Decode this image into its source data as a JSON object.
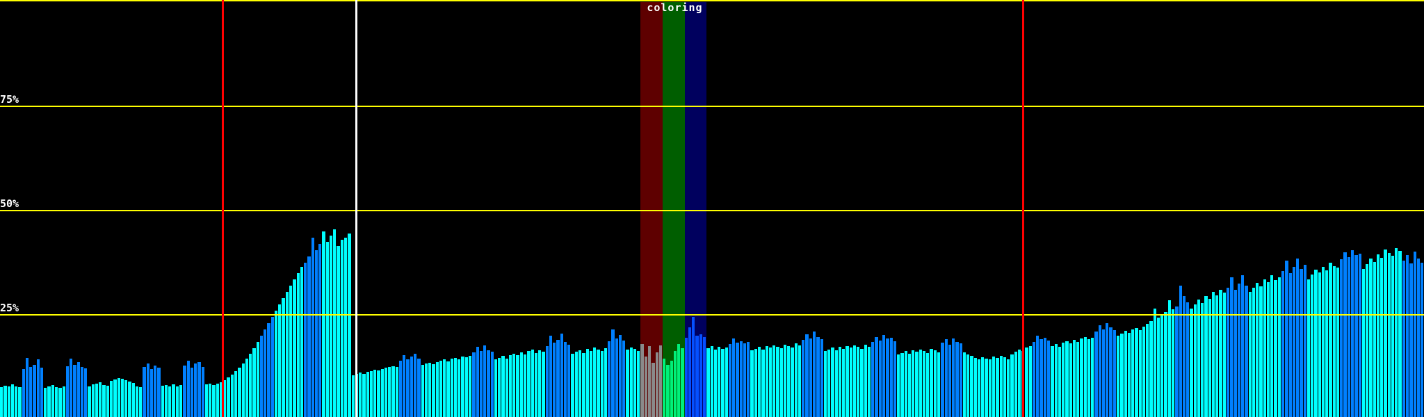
{
  "chart_data": {
    "type": "bar",
    "title": "",
    "xlabel": "",
    "ylabel": "",
    "ylim": [
      0,
      100
    ],
    "grid": "horizontal-yellow",
    "ytick_labels": [
      "75%",
      "50%",
      "25%"
    ],
    "coloring_label": "coloring",
    "gridlines": [
      {
        "label": "",
        "y_frac": 0.0
      },
      {
        "label": "75%",
        "y_frac": 0.2533
      },
      {
        "label": "50%",
        "y_frac": 0.5033
      },
      {
        "label": "25%",
        "y_frac": 0.7533
      }
    ],
    "markers": [
      {
        "type": "red",
        "x_frac": 0.1563
      },
      {
        "type": "white",
        "x_frac": 0.25
      },
      {
        "type": "red",
        "x_frac": 0.7183
      }
    ],
    "colors": {
      "background": "#000000",
      "grid": "#ffff00",
      "text": "#ffffff",
      "red": "#ff0000",
      "white": "#ffffff",
      "cyan": "#00ffff",
      "blue": "#0080ff",
      "gray": "#8a8a8a",
      "green": "#00f07a",
      "brightblue": "#0550ff"
    },
    "band_for": {
      "gray": "#5e0000",
      "green": "#005e00",
      "brightblue": "#00005e"
    },
    "segments": [
      {
        "c": "cyan",
        "h": [
          7.2,
          7.5,
          7.3,
          7.8,
          7.4,
          7.2
        ]
      },
      {
        "c": "blue",
        "h": [
          11.5,
          14.2,
          12.0,
          12.5,
          13.8,
          11.8
        ]
      },
      {
        "c": "cyan",
        "h": [
          7.0,
          7.3,
          7.6,
          7.2,
          7.0,
          7.4
        ]
      },
      {
        "c": "blue",
        "h": [
          12.2,
          14.0,
          12.5,
          13.2,
          12.0,
          11.6
        ]
      },
      {
        "c": "cyan",
        "h": [
          7.4,
          7.8,
          8.0,
          8.3,
          7.6,
          7.5
        ]
      },
      {
        "c": "cyan",
        "h": [
          8.6,
          9.0,
          9.4,
          9.2,
          8.8,
          8.5,
          8.2
        ]
      },
      {
        "c": "cyan",
        "h": [
          7.3,
          7.1
        ]
      },
      {
        "c": "blue",
        "h": [
          12.0,
          12.8,
          11.5,
          12.3,
          11.9
        ]
      },
      {
        "c": "cyan",
        "h": [
          7.5,
          7.7,
          7.3,
          7.9,
          7.4,
          7.6
        ]
      },
      {
        "c": "blue",
        "h": [
          12.4,
          13.5,
          11.8,
          12.9,
          13.1,
          12.0
        ]
      },
      {
        "c": "cyan",
        "h": [
          7.8,
          8.0,
          7.6
        ]
      },
      {
        "c": "cyan",
        "h": [
          8.0,
          8.4,
          8.9,
          9.5,
          10.2,
          11.0,
          11.9,
          12.9,
          14.0,
          15.2,
          16.5,
          18.0
        ]
      },
      {
        "c": "blue",
        "h": [
          19.5,
          21.0,
          22.5,
          24.0
        ]
      },
      {
        "c": "cyan",
        "h": [
          25.5,
          27.0,
          28.5,
          30.0,
          31.5,
          33.0,
          34.5,
          36.0
        ]
      },
      {
        "c": "blue",
        "h": [
          37.0,
          38.5,
          43.0,
          40.0,
          41.5
        ]
      },
      {
        "c": "cyan",
        "h": [
          44.5,
          42.0,
          43.5,
          45.0,
          41.0,
          42.5,
          43.0,
          44.0
        ]
      },
      {
        "c": "cyan",
        "h": [
          10.0,
          10.3,
          10.6,
          10.4,
          10.8,
          11.0,
          11.3,
          11.1,
          11.5,
          11.8,
          12.0,
          12.2,
          12.0
        ]
      },
      {
        "c": "blue",
        "h": [
          13.5,
          14.8,
          13.9,
          14.5,
          15.2,
          14.0
        ]
      },
      {
        "c": "cyan",
        "h": [
          12.5,
          12.8,
          13.0,
          12.6,
          13.2,
          13.5,
          13.8,
          13.4,
          14.0,
          14.2,
          13.9,
          14.5,
          14.3,
          14.6
        ]
      },
      {
        "c": "blue",
        "h": [
          15.5,
          16.8,
          15.9,
          17.2,
          16.0,
          15.6
        ]
      },
      {
        "c": "cyan",
        "h": [
          13.8,
          14.2,
          14.6,
          14.0,
          14.8,
          15.2,
          14.9,
          15.5,
          15.0,
          15.8,
          16.2,
          15.4,
          16.0,
          15.6
        ]
      },
      {
        "c": "blue",
        "h": [
          17.0,
          19.5,
          17.8,
          18.5,
          20.0,
          18.0,
          17.4
        ]
      },
      {
        "c": "cyan",
        "h": [
          15.2,
          15.6,
          16.0,
          15.4,
          16.4,
          15.8,
          16.6,
          16.2,
          15.9,
          16.5
        ]
      },
      {
        "c": "blue",
        "h": [
          18.2,
          21.0,
          18.8,
          19.6,
          18.4
        ]
      },
      {
        "c": "cyan",
        "h": [
          16.1,
          16.7,
          16.3,
          15.8
        ]
      },
      {
        "c": "gray",
        "h": [
          17.5,
          14.5,
          17.0,
          13.0,
          15.5,
          17.2
        ]
      },
      {
        "c": "green",
        "h": [
          14.0,
          12.5,
          13.5,
          15.8,
          17.5,
          16.5
        ]
      },
      {
        "c": "brightblue",
        "h": [
          19.0,
          21.5,
          24.0,
          19.5,
          19.8,
          19.2
        ]
      },
      {
        "c": "cyan",
        "h": [
          16.5,
          17.0,
          16.2,
          16.8,
          16.4,
          16.6
        ]
      },
      {
        "c": "blue",
        "h": [
          17.5,
          18.8,
          17.9,
          18.2,
          17.6,
          18.0
        ]
      },
      {
        "c": "cyan",
        "h": [
          16.0,
          16.4,
          16.8,
          16.2,
          17.0,
          16.6,
          17.2,
          16.9,
          16.5,
          17.4,
          17.0,
          16.7,
          17.6,
          17.2
        ]
      },
      {
        "c": "blue",
        "h": [
          18.5,
          19.8,
          18.9,
          20.5,
          19.2,
          18.6
        ]
      },
      {
        "c": "cyan",
        "h": [
          15.8,
          16.2,
          16.6,
          16.0,
          16.8,
          16.4,
          17.0,
          16.6,
          17.2,
          16.8,
          16.3,
          17.4,
          16.9
        ]
      },
      {
        "c": "blue",
        "h": [
          18.0,
          19.2,
          18.4,
          19.6,
          18.8,
          19.0,
          18.2
        ]
      },
      {
        "c": "cyan",
        "h": [
          15.0,
          15.4,
          15.8,
          15.2,
          16.0,
          15.6,
          16.2,
          15.8,
          15.3,
          16.4,
          16.0,
          15.5
        ]
      },
      {
        "c": "blue",
        "h": [
          17.8,
          18.6,
          17.4,
          18.9,
          18.0,
          17.6
        ]
      },
      {
        "c": "cyan",
        "h": [
          15.5,
          15.0,
          14.6,
          14.2,
          13.9,
          14.4,
          14.0,
          13.8,
          14.5,
          14.1,
          14.7,
          14.3,
          13.9
        ]
      },
      {
        "c": "cyan",
        "h": [
          15.0,
          15.6,
          16.2,
          15.8,
          16.6,
          17.0
        ]
      },
      {
        "c": "blue",
        "h": [
          18.0,
          19.5,
          18.6,
          19.0,
          18.4
        ]
      },
      {
        "c": "cyan",
        "h": [
          17.0,
          17.5,
          16.8,
          17.8,
          18.2,
          17.6,
          18.5,
          18.0,
          18.8,
          19.2,
          18.6,
          19.0
        ]
      },
      {
        "c": "blue",
        "h": [
          20.5,
          22.0,
          21.0,
          22.5,
          21.5,
          20.8
        ]
      },
      {
        "c": "cyan",
        "h": [
          19.5,
          20.0,
          20.6,
          20.2,
          21.0,
          21.4,
          20.8,
          21.6
        ]
      },
      {
        "c": "cyan",
        "h": [
          22.4,
          23.0,
          26.0,
          23.8,
          24.6,
          25.2,
          28.0,
          25.8
        ]
      },
      {
        "c": "blue",
        "h": [
          26.5,
          31.5,
          29.0,
          27.5
        ]
      },
      {
        "c": "cyan",
        "h": [
          26.0,
          27.0,
          28.2,
          27.4,
          29.0,
          28.4,
          30.0,
          29.2,
          30.5,
          29.8
        ]
      },
      {
        "c": "blue",
        "h": [
          31.0,
          33.5,
          30.5,
          32.0,
          34.0,
          31.5
        ]
      },
      {
        "c": "cyan",
        "h": [
          30.0,
          31.0,
          32.2,
          31.4,
          33.0,
          32.4,
          34.0,
          32.8,
          33.5
        ]
      },
      {
        "c": "blue",
        "h": [
          35.0,
          37.5,
          34.5,
          36.0,
          38.0,
          35.5,
          36.5
        ]
      },
      {
        "c": "cyan",
        "h": [
          33.0,
          34.2,
          35.4,
          34.6,
          36.0,
          35.2,
          37.0,
          36.2,
          35.8
        ]
      },
      {
        "c": "blue",
        "h": [
          37.8,
          39.5,
          38.4,
          40.0,
          38.8,
          39.2
        ]
      },
      {
        "c": "cyan",
        "h": [
          35.5,
          36.6,
          38.0,
          37.2,
          39.0,
          38.2,
          40.2,
          39.4,
          38.6,
          40.5,
          39.8
        ]
      },
      {
        "c": "blue",
        "h": [
          37.5,
          38.8,
          36.8,
          39.6,
          38.0,
          37.0
        ]
      }
    ]
  }
}
